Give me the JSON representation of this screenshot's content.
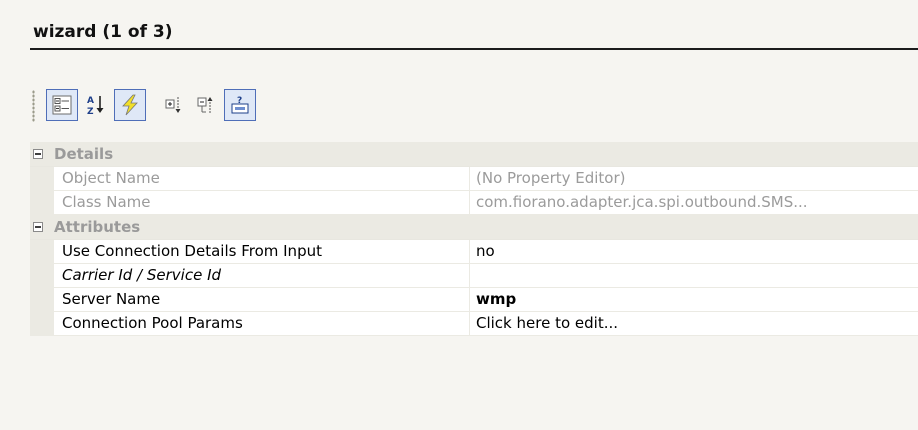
{
  "title": "wizard (1 of 3)",
  "toolbar": {
    "buttons": [
      {
        "icon": "categorized-icon",
        "active": true
      },
      {
        "icon": "sort-alphabetical-icon",
        "active": false
      },
      {
        "icon": "lightning-icon",
        "active": true
      },
      {
        "icon": "expand-all-icon",
        "active": false
      },
      {
        "icon": "collapse-all-icon",
        "active": false
      },
      {
        "icon": "help-export-icon",
        "active": true
      }
    ]
  },
  "grid": {
    "categories": [
      {
        "label": "Details",
        "expanded": true,
        "properties": [
          {
            "name": "Object Name",
            "value": "(No Property Editor)",
            "readonly": true
          },
          {
            "name": "Class Name",
            "value": "com.fiorano.adapter.jca.spi.outbound.SMS...",
            "readonly": true
          }
        ]
      },
      {
        "label": "Attributes",
        "expanded": true,
        "properties": [
          {
            "name": "Use Connection Details From Input",
            "value": "no"
          },
          {
            "name": "Carrier Id / Service Id",
            "value": ""
          },
          {
            "name": "Server Name",
            "value": "wmp"
          },
          {
            "name": "Connection Pool Params",
            "value": "Click here to edit..."
          }
        ]
      }
    ]
  }
}
